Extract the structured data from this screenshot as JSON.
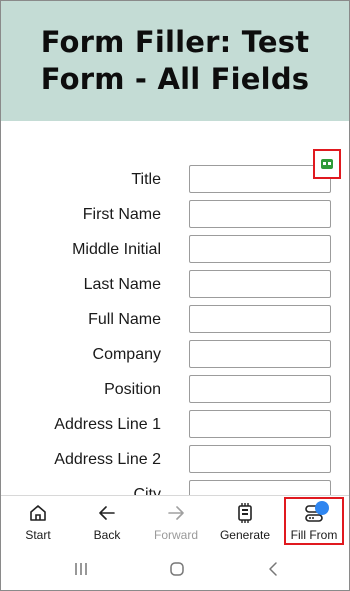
{
  "header": {
    "title": "Form Filler: Test Form - All Fields"
  },
  "form": {
    "fields": [
      {
        "label": "Title",
        "value": ""
      },
      {
        "label": "First Name",
        "value": ""
      },
      {
        "label": "Middle Initial",
        "value": ""
      },
      {
        "label": "Last Name",
        "value": ""
      },
      {
        "label": "Full Name",
        "value": ""
      },
      {
        "label": "Company",
        "value": ""
      },
      {
        "label": "Position",
        "value": ""
      },
      {
        "label": "Address Line 1",
        "value": ""
      },
      {
        "label": "Address Line 2",
        "value": ""
      },
      {
        "label": "City",
        "value": ""
      }
    ]
  },
  "bottom_nav": {
    "items": [
      {
        "label": "Start",
        "icon": "home-icon",
        "enabled": true
      },
      {
        "label": "Back",
        "icon": "arrow-left-icon",
        "enabled": true
      },
      {
        "label": "Forward",
        "icon": "arrow-right-icon",
        "enabled": false
      },
      {
        "label": "Generate",
        "icon": "generate-icon",
        "enabled": true
      },
      {
        "label": "Fill From",
        "icon": "fill-from-icon",
        "enabled": true
      }
    ]
  },
  "colors": {
    "header_bg": "#c4dcd5",
    "highlight": "#e0191f",
    "notification_dot": "#2f86f0",
    "autofill_icon": "#2f9a37"
  },
  "system_nav": {
    "icons": [
      "recents-icon",
      "home-circle-icon",
      "back-chevron-icon"
    ]
  }
}
